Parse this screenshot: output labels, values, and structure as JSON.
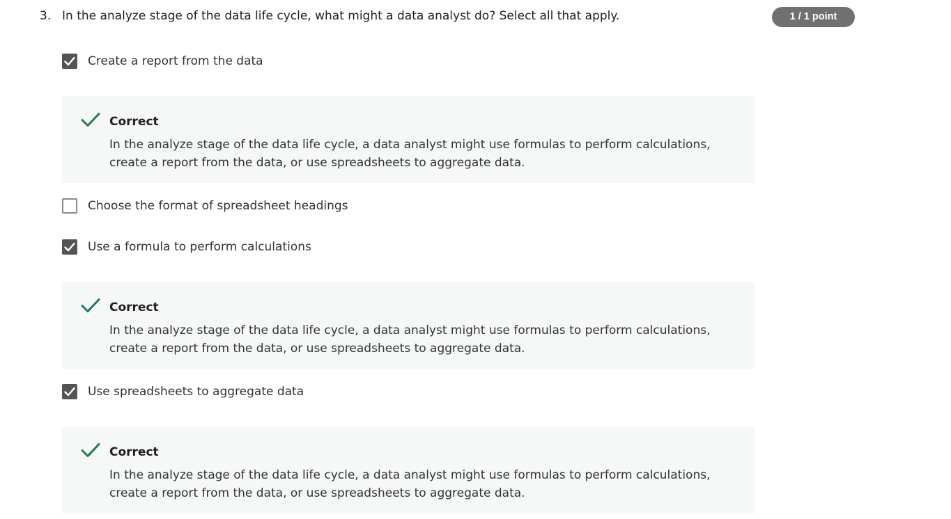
{
  "question": {
    "number": "3.",
    "text": "In the analyze stage of the data life cycle, what might a data analyst do? Select all that apply.",
    "points": "1 / 1 point"
  },
  "options": [
    {
      "label": "Create a report from the data",
      "checked": true
    },
    {
      "label": "Choose the format of spreadsheet headings",
      "checked": false
    },
    {
      "label": "Use a formula to perform calculations",
      "checked": true
    },
    {
      "label": "Use spreadsheets to aggregate data",
      "checked": true
    }
  ],
  "feedback": [
    {
      "title": "Correct",
      "text": "In the analyze stage of the data life cycle, a data analyst might use formulas to perform calculations, create a report from the data, or use spreadsheets to aggregate data."
    },
    {
      "title": "Correct",
      "text": "In the analyze stage of the data life cycle, a data analyst might use formulas to perform calculations, create a report from the data, or use spreadsheets to aggregate data."
    },
    {
      "title": "Correct",
      "text": "In the analyze stage of the data life cycle, a data analyst might use formulas to perform calculations, create a report from the data, or use spreadsheets to aggregate data."
    }
  ],
  "colors": {
    "correct_green": "#1f7a4f",
    "checkbox_fill": "#545454",
    "feedback_bg": "#f5f8f7",
    "badge_bg": "#707070"
  },
  "icons": {
    "checkbox_checked": "checkmark-icon",
    "feedback_correct": "correct-check-icon"
  }
}
